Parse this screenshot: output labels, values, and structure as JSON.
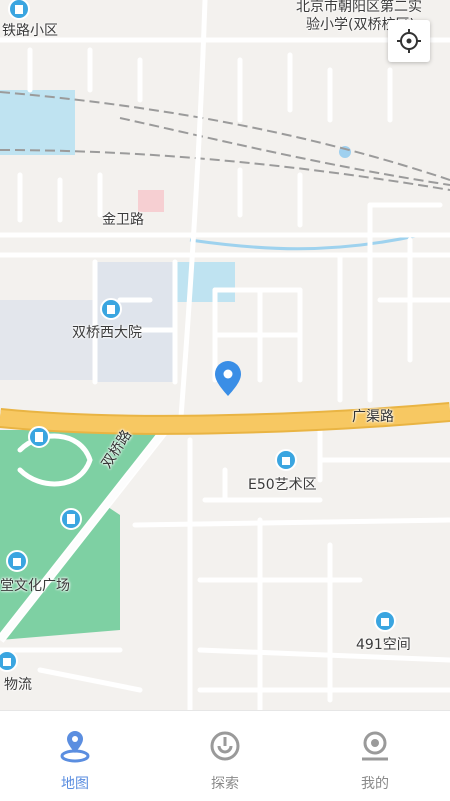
{
  "map": {
    "labels": {
      "tiejulu": "铁路小区",
      "school_line1": "北京市朝阳区第二实",
      "school_line2": "验小学(双桥校区)",
      "jinweilu": "金卫路",
      "shuangqiao_xidayuan": "双桥西大院",
      "guangqulu": "广渠路",
      "shuangqiao_road": "双桥路",
      "e50": "E50艺术区",
      "culture_square": "堂文化广场",
      "space491": "491空间",
      "logistics": "物流"
    },
    "colors": {
      "road_main": "#f7c862",
      "park": "#7ed0a3",
      "poi": "#3aa5e0",
      "pin": "#3a8ee6",
      "water": "#bfe3f1"
    }
  },
  "locate_button": {
    "icon": "crosshair-icon"
  },
  "tabbar": {
    "tabs": [
      {
        "label": "地图",
        "icon": "map-pin-icon",
        "active": true
      },
      {
        "label": "探索",
        "icon": "explore-icon",
        "active": false
      },
      {
        "label": "我的",
        "icon": "profile-icon",
        "active": false
      }
    ]
  }
}
